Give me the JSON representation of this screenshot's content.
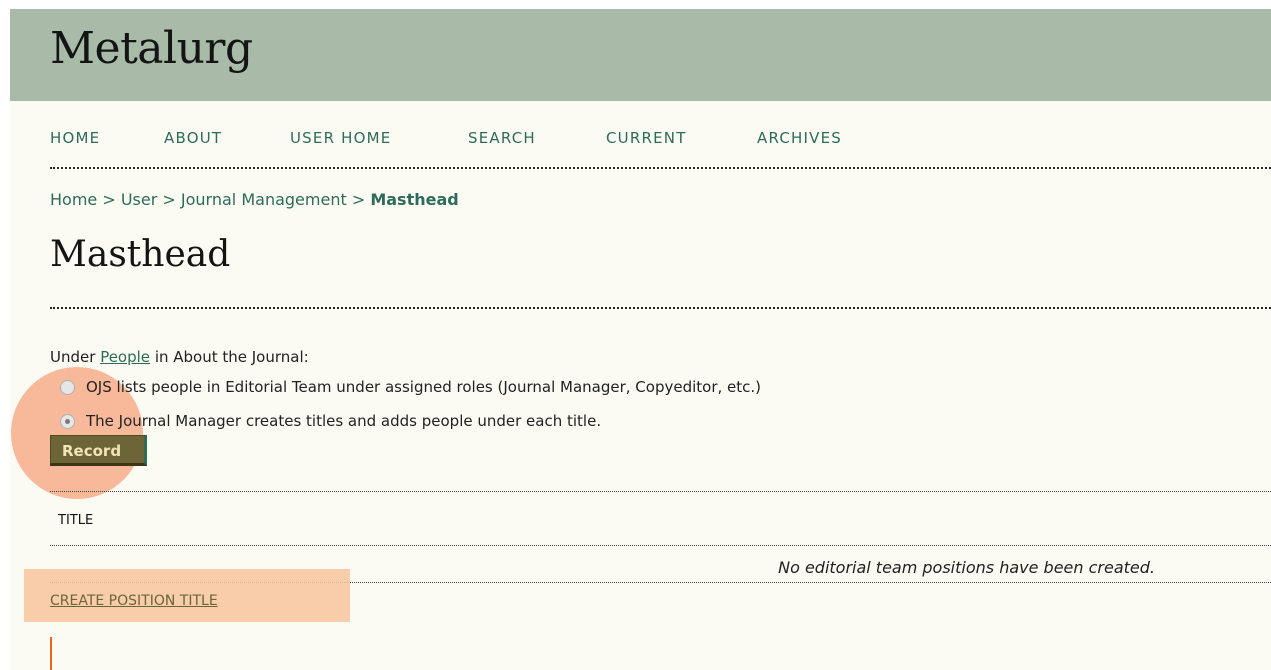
{
  "header": {
    "site_title": "Metalurg"
  },
  "nav": [
    {
      "label": "HOME"
    },
    {
      "label": "ABOUT"
    },
    {
      "label": "USER HOME"
    },
    {
      "label": "SEARCH"
    },
    {
      "label": "CURRENT"
    },
    {
      "label": "ARCHIVES"
    }
  ],
  "breadcrumb": {
    "items": [
      "Home",
      "User",
      "Journal Management"
    ],
    "separator": ">",
    "current": "Masthead"
  },
  "page_title": "Masthead",
  "form": {
    "intro_prefix": "Under",
    "intro_link": "People",
    "intro_suffix": "in About the Journal:",
    "options": [
      {
        "label": "OJS lists people in Editorial Team under assigned roles (Journal Manager, Copyeditor, etc.)",
        "checked": false
      },
      {
        "label": "The Journal Manager creates titles and adds people under each title.",
        "checked": true
      }
    ],
    "submit_label": "Record"
  },
  "table": {
    "column_header": "TITLE",
    "empty_message": "No editorial team positions have been created."
  },
  "actions": {
    "create_label": "CREATE POSITION TITLE"
  },
  "colors": {
    "header_bg": "#a8bba8",
    "page_bg": "#fbfbf3",
    "link": "#2e6b5a",
    "button_bg": "#6b6537",
    "highlight": "#f6a078",
    "cursor": "#e86a1c"
  }
}
